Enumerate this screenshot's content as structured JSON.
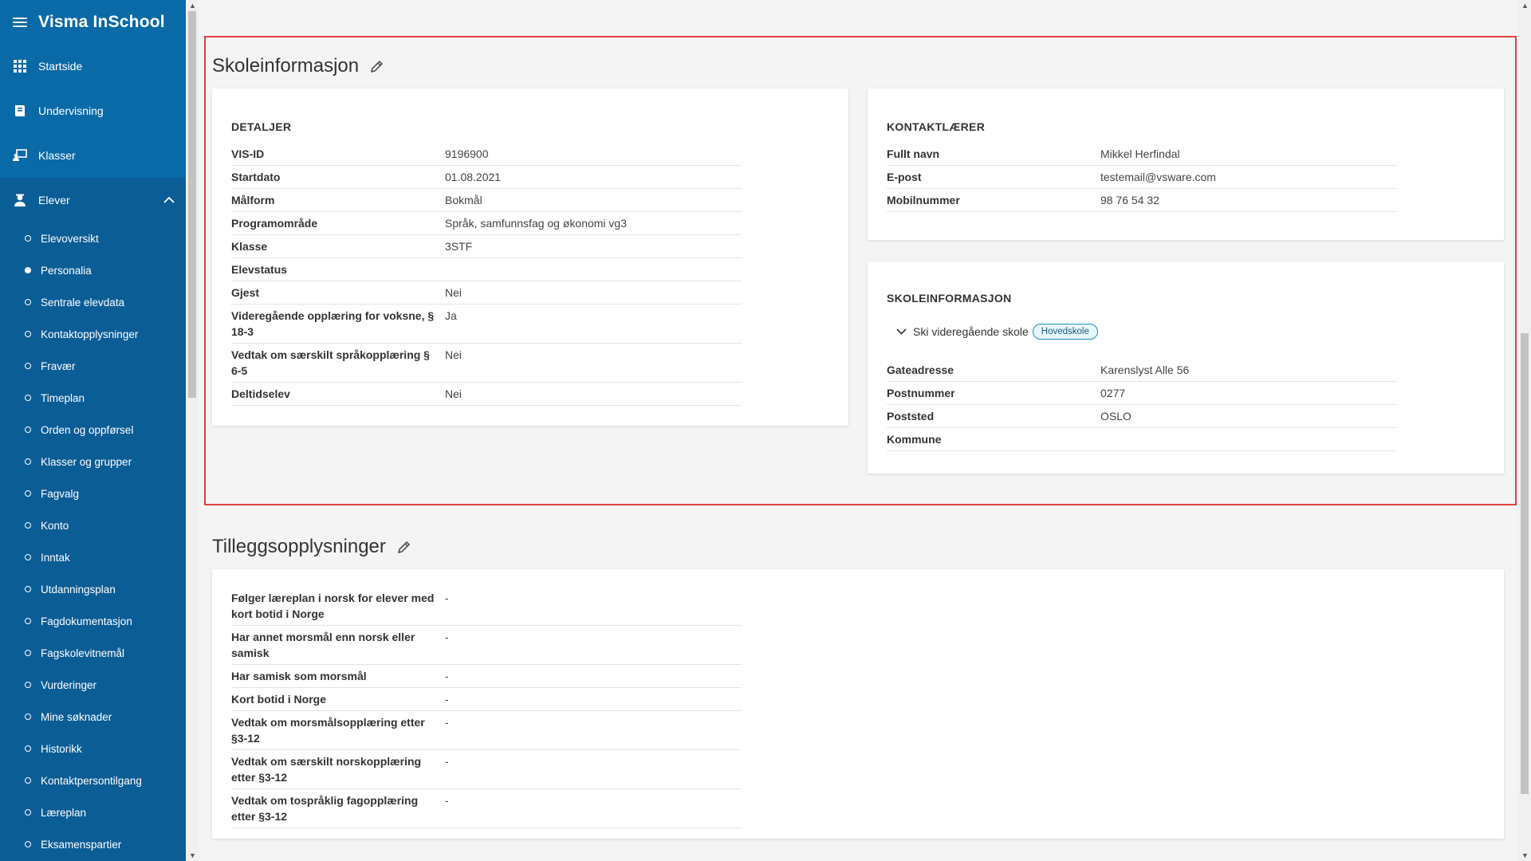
{
  "app": {
    "title": "Visma InSchool"
  },
  "sidebar": {
    "top_items": [
      {
        "label": "Startside",
        "icon": "grid-icon"
      },
      {
        "label": "Undervisning",
        "icon": "book-icon"
      },
      {
        "label": "Klasser",
        "icon": "classroom-icon"
      }
    ],
    "group": {
      "label": "Elever",
      "icon": "student-icon",
      "expanded": true
    },
    "sub_items": [
      {
        "label": "Elevoversikt",
        "active": false
      },
      {
        "label": "Personalia",
        "active": true
      },
      {
        "label": "Sentrale elevdata",
        "active": false
      },
      {
        "label": "Kontaktopplysninger",
        "active": false
      },
      {
        "label": "Fravær",
        "active": false
      },
      {
        "label": "Timeplan",
        "active": false
      },
      {
        "label": "Orden og oppførsel",
        "active": false
      },
      {
        "label": "Klasser og grupper",
        "active": false
      },
      {
        "label": "Fagvalg",
        "active": false
      },
      {
        "label": "Konto",
        "active": false
      },
      {
        "label": "Inntak",
        "active": false
      },
      {
        "label": "Utdanningsplan",
        "active": false
      },
      {
        "label": "Fagdokumentasjon",
        "active": false
      },
      {
        "label": "Fagskolevitnemål",
        "active": false
      },
      {
        "label": "Vurderinger",
        "active": false
      },
      {
        "label": "Mine søknader",
        "active": false
      },
      {
        "label": "Historikk",
        "active": false
      },
      {
        "label": "Kontaktpersontilgang",
        "active": false
      },
      {
        "label": "Læreplan",
        "active": false
      },
      {
        "label": "Eksamenspartier",
        "active": false
      }
    ]
  },
  "skoleinfo": {
    "title": "Skoleinformasjon",
    "details": {
      "heading": "DETALJER",
      "rows": [
        {
          "key": "VIS-ID",
          "value": "9196900"
        },
        {
          "key": "Startdato",
          "value": "01.08.2021"
        },
        {
          "key": "Målform",
          "value": "Bokmål"
        },
        {
          "key": "Programområde",
          "value": "Språk, samfunnsfag og økonomi vg3"
        },
        {
          "key": "Klasse",
          "value": "3STF"
        },
        {
          "key": "Elevstatus",
          "value": ""
        },
        {
          "key": "Gjest",
          "value": "Nei"
        },
        {
          "key": "Videregående opplæring for voksne, § 18-3",
          "value": "Ja"
        },
        {
          "key": "Vedtak om særskilt språkopplæring § 6-5",
          "value": "Nei"
        },
        {
          "key": "Deltidselev",
          "value": "Nei"
        }
      ]
    },
    "contact": {
      "heading": "KONTAKTLÆRER",
      "rows": [
        {
          "key": "Fullt navn",
          "value": "Mikkel Herfindal"
        },
        {
          "key": "E-post",
          "value": "testemail@vsware.com"
        },
        {
          "key": "Mobilnummer",
          "value": "98 76 54 32"
        }
      ]
    },
    "school": {
      "heading": "SKOLEINFORMASJON",
      "name": "Ski videregående skole",
      "badge": "Hovedskole",
      "rows": [
        {
          "key": "Gateadresse",
          "value": "Karenslyst Alle 56"
        },
        {
          "key": "Postnummer",
          "value": "0277"
        },
        {
          "key": "Poststed",
          "value": "OSLO"
        },
        {
          "key": "Kommune",
          "value": ""
        }
      ]
    }
  },
  "tillegg": {
    "title": "Tilleggsopplysninger",
    "rows": [
      {
        "key": "Følger læreplan i norsk for elever med kort botid i Norge",
        "value": "-"
      },
      {
        "key": "Har annet morsmål enn norsk eller samisk",
        "value": "-"
      },
      {
        "key": "Har samisk som morsmål",
        "value": "-"
      },
      {
        "key": "Kort botid i Norge",
        "value": "-"
      },
      {
        "key": "Vedtak om morsmålsopplæring etter §3-12",
        "value": "-"
      },
      {
        "key": "Vedtak om særskilt norskopplæring etter §3-12",
        "value": "-"
      },
      {
        "key": "Vedtak om tospråklig fagopplæring etter §3-12",
        "value": "-"
      }
    ]
  },
  "colors": {
    "sidebar": "#0a6aa8",
    "sidebar_group": "#0b5d96",
    "highlight": "#e0413f",
    "badge_border": "#1c8fc7"
  }
}
